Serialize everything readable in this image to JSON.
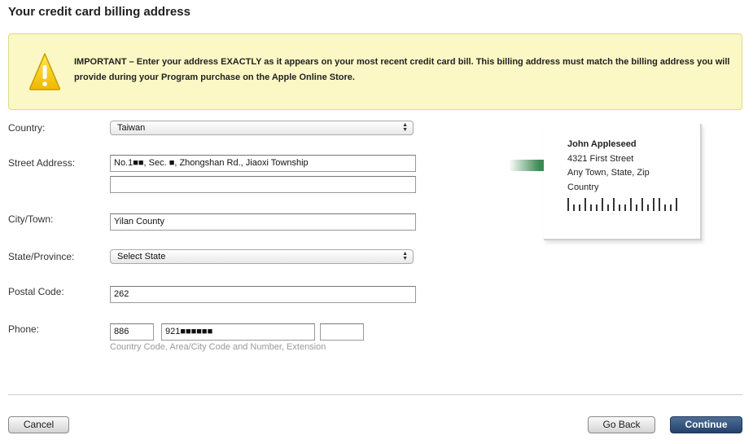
{
  "page": {
    "title": "Your credit card billing address"
  },
  "notice": {
    "icon": "warning-icon",
    "text": "IMPORTANT – Enter your address EXACTLY as it appears on your most recent credit card bill. This billing address must match the billing address you will provide during your Program purchase on the Apple Online Store."
  },
  "form": {
    "country": {
      "label": "Country:",
      "value": "Taiwan"
    },
    "street": {
      "label": "Street Address:",
      "line1": "No.1■■, Sec. ■, Zhongshan Rd., Jiaoxi Township",
      "line2": ""
    },
    "city": {
      "label": "City/Town:",
      "value": "Yilan County"
    },
    "state": {
      "label": "State/Province:",
      "value": "Select State"
    },
    "postal": {
      "label": "Postal Code:",
      "value": "262"
    },
    "phone": {
      "label": "Phone:",
      "country_code": "886",
      "number": "921■■■■■■",
      "extension": "",
      "hint": "Country Code, Area/City Code and Number, Extension"
    }
  },
  "sample_address": {
    "name": "John Appleseed",
    "street": "4321 First Street",
    "city_line": "Any Town, State, Zip",
    "country": "Country",
    "arrow_color": "#3d8a55"
  },
  "buttons": {
    "cancel": "Cancel",
    "back": "Go Back",
    "continue": "Continue"
  }
}
